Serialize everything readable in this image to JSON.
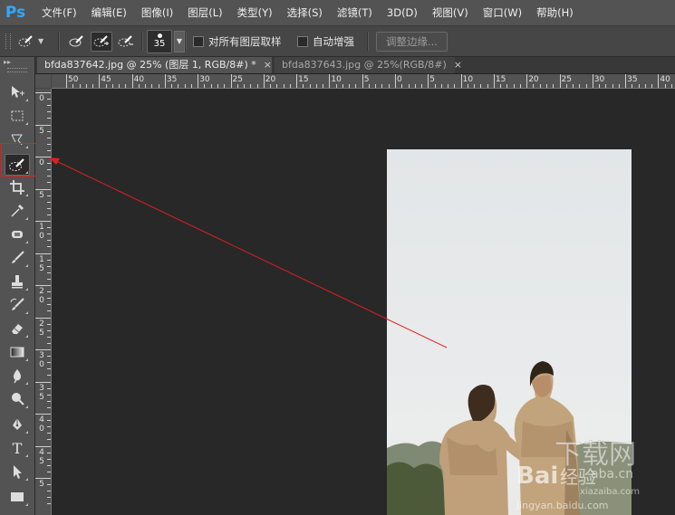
{
  "app": {
    "logo": "Ps"
  },
  "menu": [
    "文件(F)",
    "编辑(E)",
    "图像(I)",
    "图层(L)",
    "类型(Y)",
    "选择(S)",
    "滤镜(T)",
    "3D(D)",
    "视图(V)",
    "窗口(W)",
    "帮助(H)"
  ],
  "options": {
    "brush_size": "35",
    "sample_all_layers": "对所有图层取样",
    "auto_enhance": "自动增强",
    "refine_edge": "调整边缘..."
  },
  "tabs": [
    {
      "label": "bfda837642.jpg @ 25% (图层 1, RGB/8#) *",
      "close": "×"
    },
    {
      "label": "bfda837643.jpg @ 25%(RGB/8#)",
      "close": "×"
    }
  ],
  "ruler": {
    "h_labels": [
      "50",
      "45",
      "40",
      "35",
      "30",
      "25",
      "20",
      "15",
      "10",
      "5",
      "0",
      "5",
      "10",
      "15",
      "20",
      "25",
      "30",
      "35",
      "40"
    ],
    "v_labels": [
      "0",
      "5",
      "0",
      "5",
      "1 0",
      "1 5",
      "2 0",
      "2 5",
      "3 0",
      "3 5",
      "4 0",
      "4 5",
      "5"
    ]
  },
  "tools": [
    "move-tool",
    "marquee-tool",
    "lasso-tool",
    "quick-selection-tool",
    "crop-tool",
    "eyedropper-tool",
    "spot-healing-tool",
    "brush-tool",
    "clone-stamp-tool",
    "history-brush-tool",
    "eraser-tool",
    "gradient-tool",
    "blur-tool",
    "dodge-tool",
    "pen-tool",
    "type-tool",
    "path-selection-tool",
    "rectangle-tool"
  ],
  "tool_type_glyph": "T",
  "colors": {
    "annotation": "#e02020",
    "accent": "#31a8ff"
  },
  "watermark": {
    "main": "下载网",
    "baidu": "Bai",
    "baidu_paw": "经验",
    "url": "jingyan.baidu.com",
    "site": "xiazaiba.com",
    "site_short": "aba.cn"
  }
}
